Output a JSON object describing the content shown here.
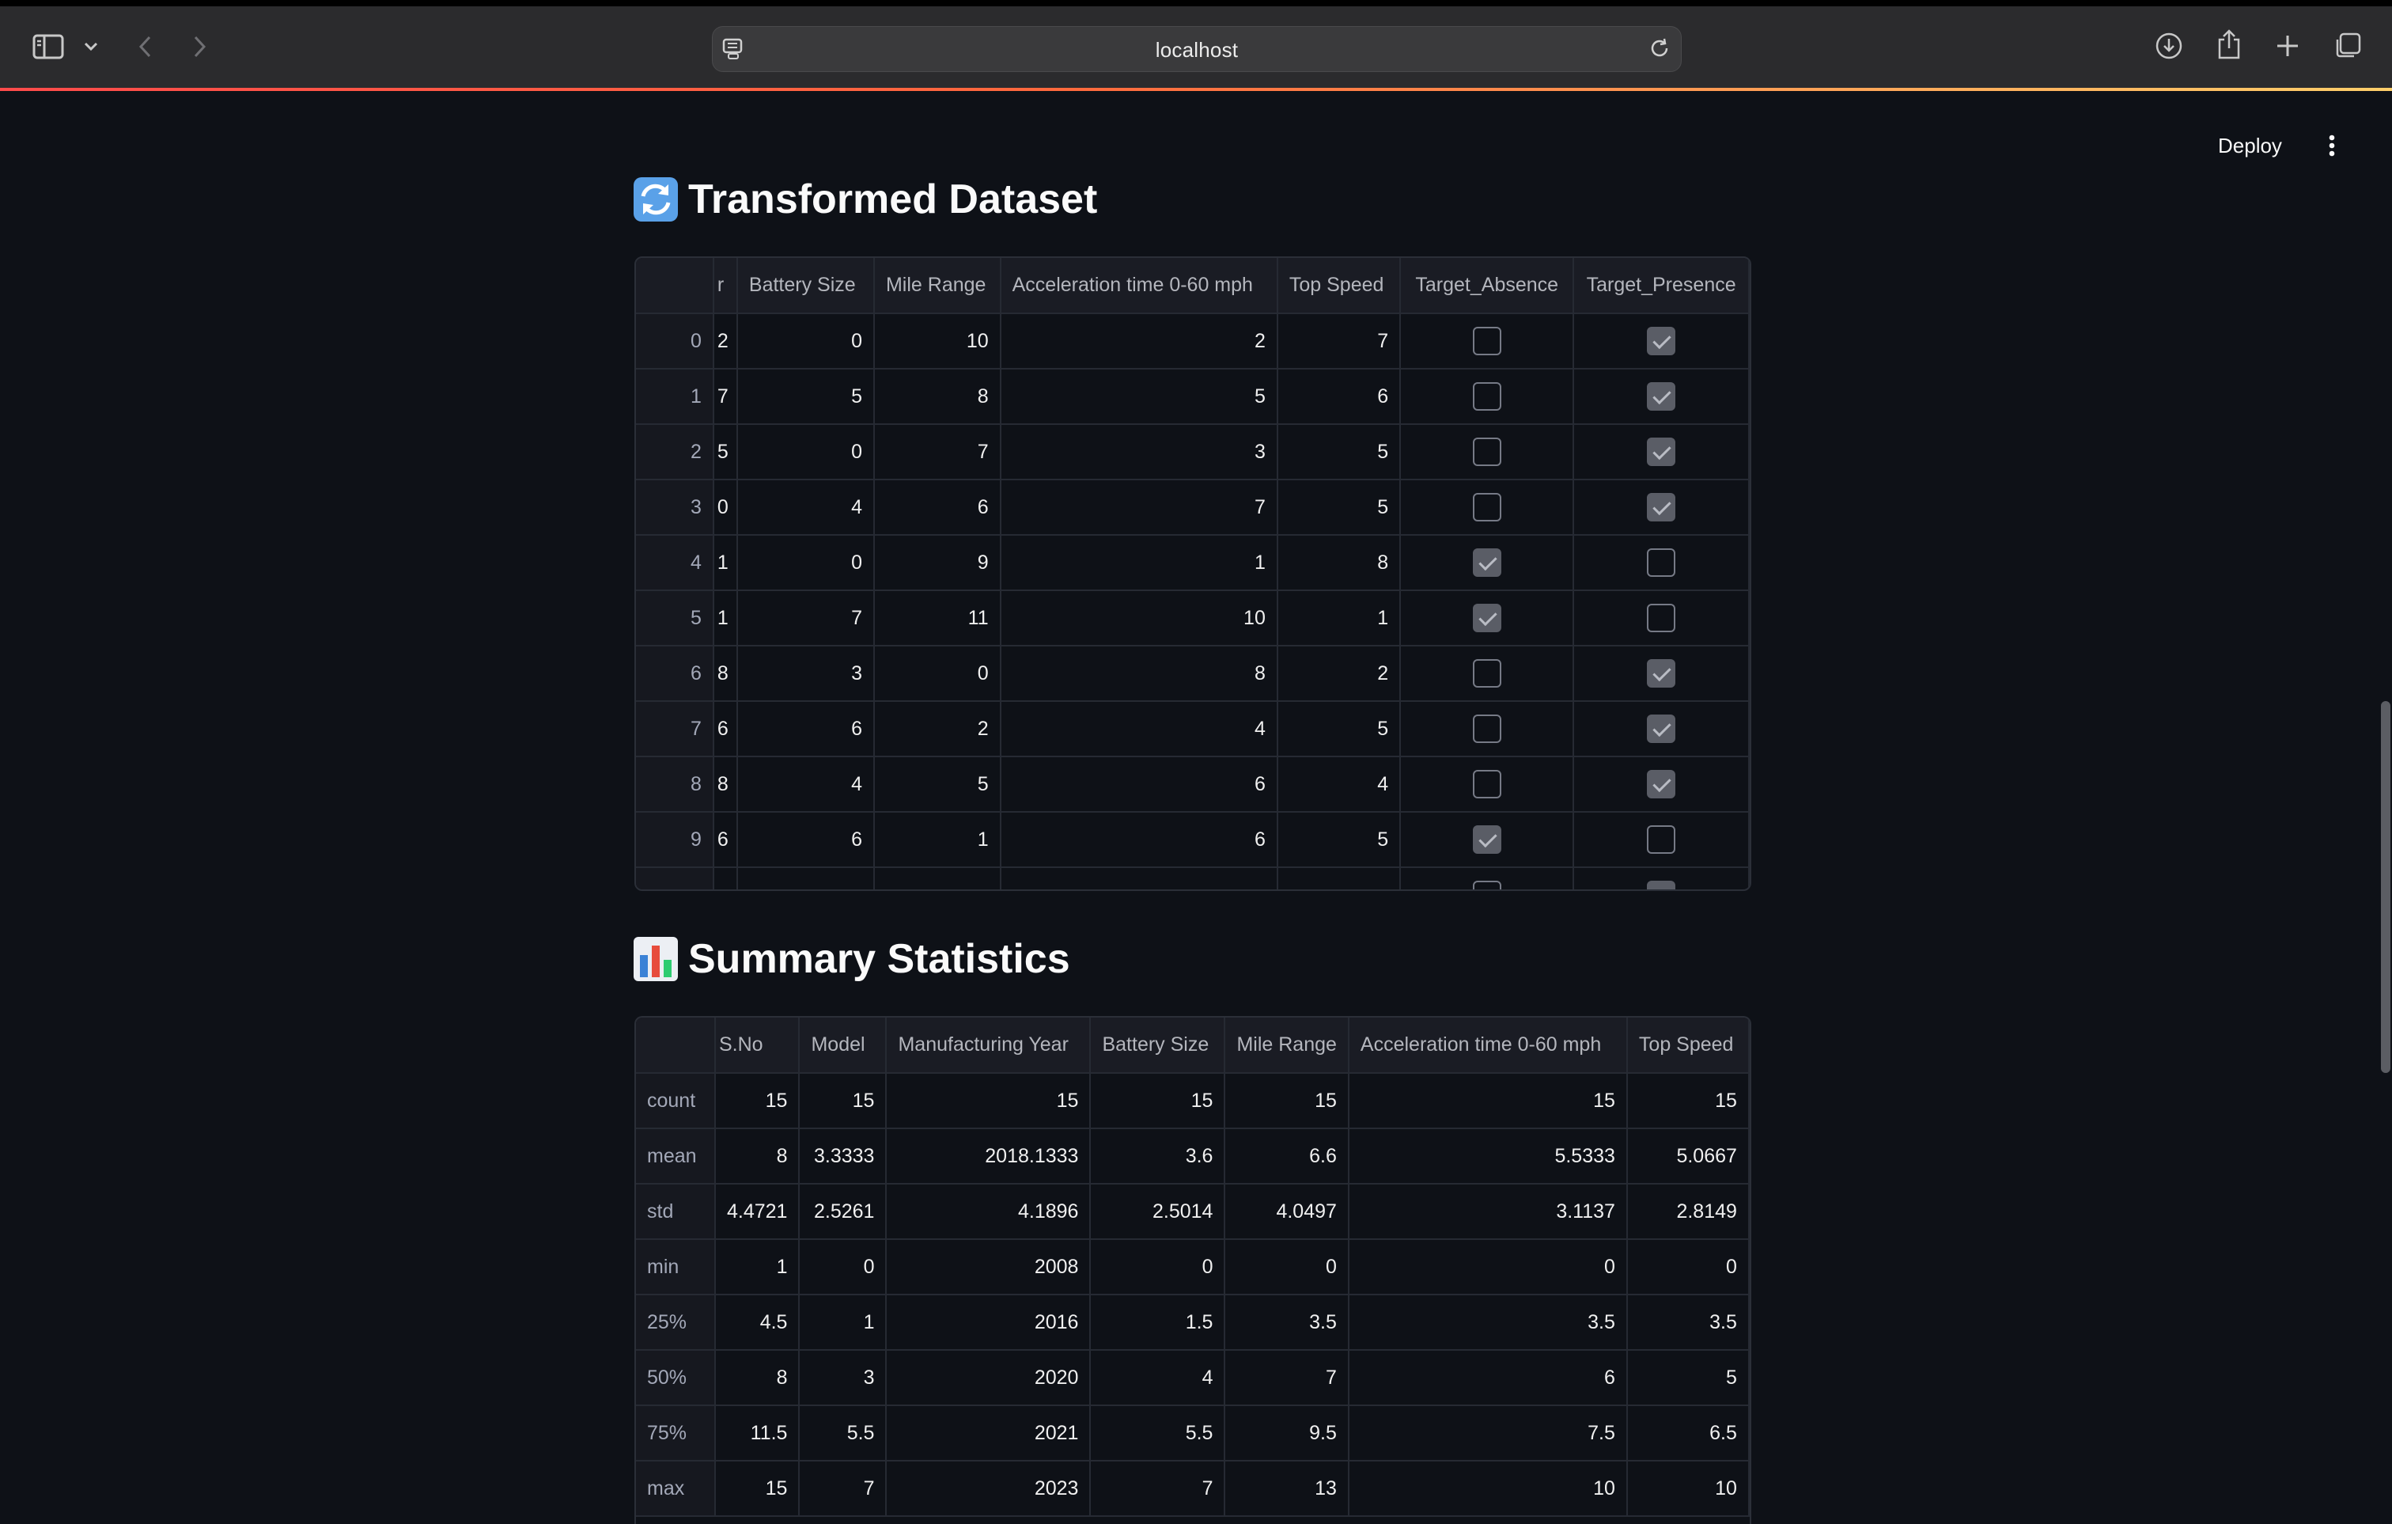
{
  "browser": {
    "url": "localhost"
  },
  "app": {
    "deploy_label": "Deploy"
  },
  "transformed": {
    "title": "Transformed Dataset",
    "icon": "counterclockwise-arrows-emoji",
    "columns": [
      "r",
      "Battery Size",
      "Mile Range",
      "Acceleration time 0-60 mph",
      "Top Speed",
      "Target_Absence",
      "Target_Presence"
    ],
    "rows": [
      {
        "index": "0",
        "first": "2",
        "battery": "0",
        "mile": "10",
        "accel": "2",
        "speed": "7",
        "absence": false,
        "presence": true
      },
      {
        "index": "1",
        "first": "7",
        "battery": "5",
        "mile": "8",
        "accel": "5",
        "speed": "6",
        "absence": false,
        "presence": true
      },
      {
        "index": "2",
        "first": "5",
        "battery": "0",
        "mile": "7",
        "accel": "3",
        "speed": "5",
        "absence": false,
        "presence": true
      },
      {
        "index": "3",
        "first": "0",
        "battery": "4",
        "mile": "6",
        "accel": "7",
        "speed": "5",
        "absence": false,
        "presence": true
      },
      {
        "index": "4",
        "first": "1",
        "battery": "0",
        "mile": "9",
        "accel": "1",
        "speed": "8",
        "absence": true,
        "presence": false
      },
      {
        "index": "5",
        "first": "1",
        "battery": "7",
        "mile": "11",
        "accel": "10",
        "speed": "1",
        "absence": true,
        "presence": false
      },
      {
        "index": "6",
        "first": "8",
        "battery": "3",
        "mile": "0",
        "accel": "8",
        "speed": "2",
        "absence": false,
        "presence": true
      },
      {
        "index": "7",
        "first": "6",
        "battery": "6",
        "mile": "2",
        "accel": "4",
        "speed": "5",
        "absence": false,
        "presence": true
      },
      {
        "index": "8",
        "first": "8",
        "battery": "4",
        "mile": "5",
        "accel": "6",
        "speed": "4",
        "absence": false,
        "presence": true
      },
      {
        "index": "9",
        "first": "6",
        "battery": "6",
        "mile": "1",
        "accel": "6",
        "speed": "5",
        "absence": true,
        "presence": false
      }
    ]
  },
  "summary": {
    "title": "Summary Statistics",
    "icon": "bar-chart-emoji",
    "columns": [
      "S.No",
      "Model",
      "Manufacturing Year",
      "Battery Size",
      "Mile Range",
      "Acceleration time 0-60 mph",
      "Top Speed"
    ],
    "rows": [
      {
        "label": "count",
        "values": [
          "15",
          "15",
          "15",
          "15",
          "15",
          "15",
          "15"
        ]
      },
      {
        "label": "mean",
        "values": [
          "8",
          "3.3333",
          "2018.1333",
          "3.6",
          "6.6",
          "5.5333",
          "5.0667"
        ]
      },
      {
        "label": "std",
        "values": [
          "4.4721",
          "2.5261",
          "4.1896",
          "2.5014",
          "4.0497",
          "3.1137",
          "2.8149"
        ]
      },
      {
        "label": "min",
        "values": [
          "1",
          "0",
          "2008",
          "0",
          "0",
          "0",
          "0"
        ]
      },
      {
        "label": "25%",
        "values": [
          "4.5",
          "1",
          "2016",
          "1.5",
          "3.5",
          "3.5",
          "3.5"
        ]
      },
      {
        "label": "50%",
        "values": [
          "8",
          "3",
          "2020",
          "4",
          "7",
          "6",
          "5"
        ]
      },
      {
        "label": "75%",
        "values": [
          "11.5",
          "5.5",
          "2021",
          "5.5",
          "9.5",
          "7.5",
          "6.5"
        ]
      },
      {
        "label": "max",
        "values": [
          "15",
          "7",
          "2023",
          "7",
          "13",
          "10",
          "10"
        ]
      }
    ]
  }
}
